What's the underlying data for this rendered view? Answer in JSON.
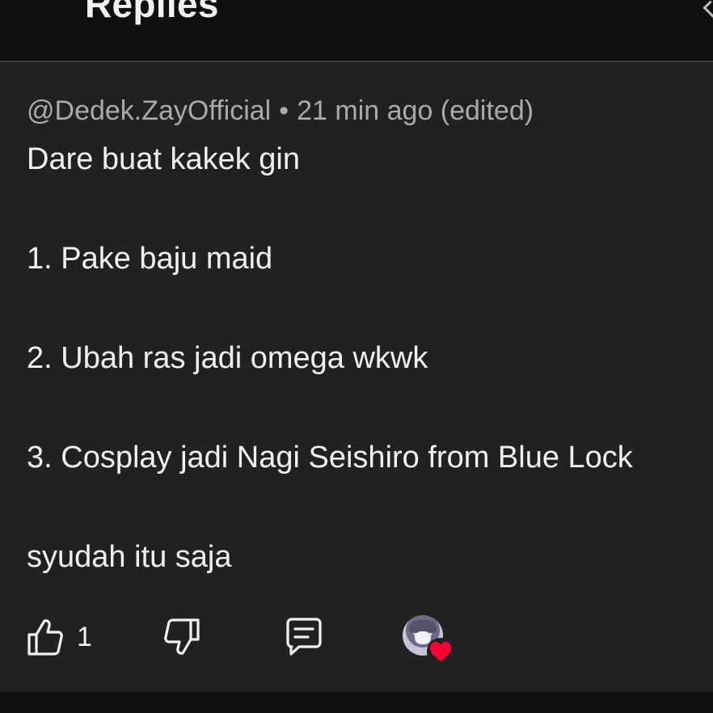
{
  "header": {
    "title": "Replies"
  },
  "comment": {
    "author": "@Dedek.ZayOfficial",
    "separator": "•",
    "time": "21 min ago (edited)",
    "lines": [
      "Dare buat kakek gin",
      "",
      "",
      "1. Pake baju maid",
      "",
      "",
      "2. Ubah ras jadi omega wkwk",
      "",
      "",
      "3. Cosplay jadi Nagi Seishiro from Blue Lock",
      "",
      "",
      "syudah itu saja"
    ],
    "like_count": "1"
  },
  "icons": {
    "like": "thumbs-up-icon",
    "dislike": "thumbs-down-icon",
    "reply": "comment-icon",
    "creator_heart": "heart-icon"
  },
  "colors": {
    "background": "#0f0f0f",
    "card": "#212121",
    "text": "#f1f1f1",
    "meta_text": "#aaaaaa",
    "heart": "#ff0033"
  }
}
